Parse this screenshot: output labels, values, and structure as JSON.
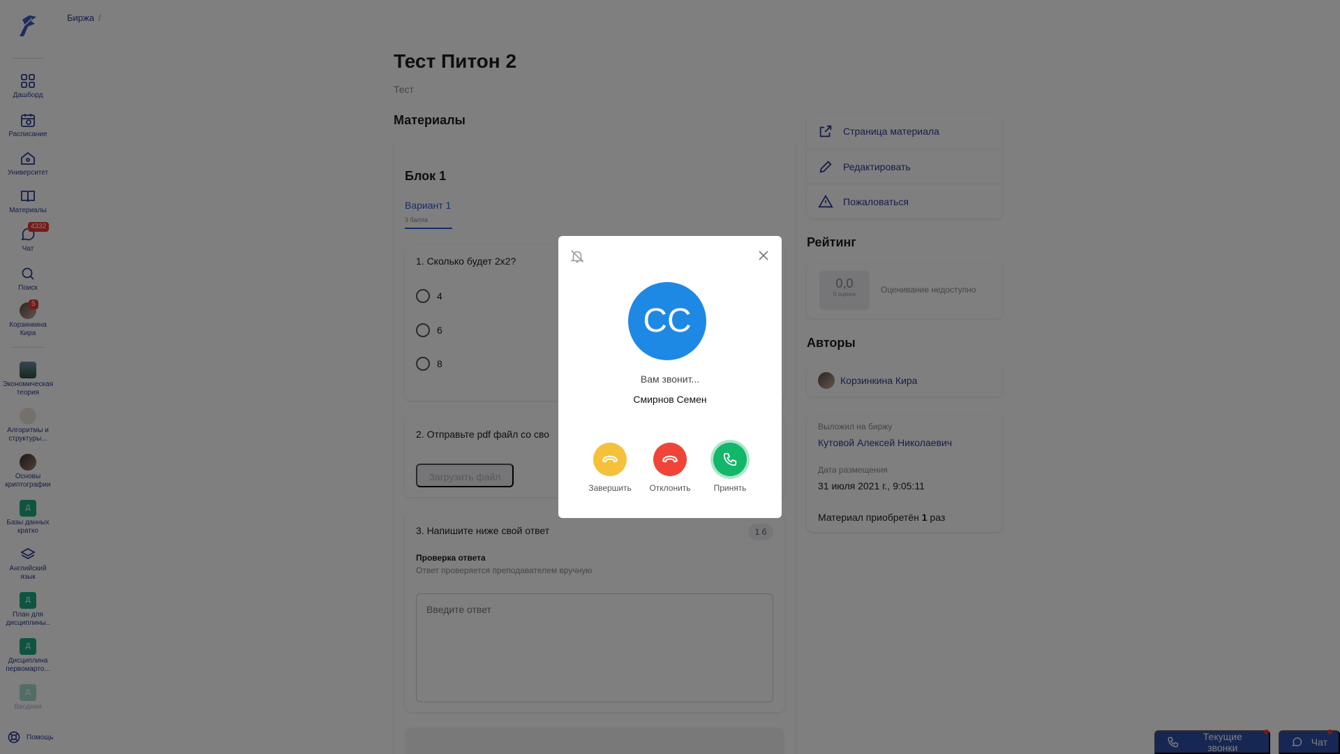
{
  "breadcrumb": {
    "item": "Биржа",
    "separator": "/"
  },
  "sidebar": {
    "items": [
      {
        "label": "Дашборд",
        "icon": "dashboard-icon"
      },
      {
        "label": "Расписание",
        "icon": "calendar-icon"
      },
      {
        "label": "Университет",
        "icon": "university-icon"
      },
      {
        "label": "Материалы",
        "icon": "book-icon"
      },
      {
        "label": "Чат",
        "icon": "chat-icon",
        "badge": "4332"
      },
      {
        "label": "Поиск",
        "icon": "search-icon"
      },
      {
        "label": "Корзинкина Кира",
        "icon": "avatar",
        "badge": "5"
      }
    ],
    "courses": [
      {
        "label": "Экономическая теория"
      },
      {
        "label": "Алгоритмы и структуры..."
      },
      {
        "label": "Основы криптографии"
      },
      {
        "label": "Базы данных кратко",
        "letter": "Д"
      },
      {
        "label": "Английский язык"
      },
      {
        "label": "План для дисциплины..",
        "letter": "Д"
      },
      {
        "label": "Дисциплина первомарто...",
        "letter": "Д"
      },
      {
        "label": "Вводная",
        "letter": "Д"
      }
    ],
    "help": "Помощь"
  },
  "page": {
    "title": "Тест Питон 2",
    "subtitle": "Тест",
    "materials_heading": "Материалы"
  },
  "block": {
    "title": "Блок 1",
    "variant_label": "Вариант 1",
    "variant_points": "3 балла",
    "q1": {
      "text": "1. Сколько будет 2х2?",
      "options": [
        "4",
        "6",
        "8"
      ]
    },
    "q2": {
      "text": "2. Отправьте pdf файл со сво",
      "upload_label": "Загрузить файл"
    },
    "q3": {
      "text": "3. Напишите ниже свой ответ",
      "badge": "1 б",
      "check_title": "Проверка ответа",
      "check_desc": "Ответ проверяется преподавателем вручную",
      "answer_placeholder": "Введите ответ"
    }
  },
  "actions": {
    "page_link": "Страница материала",
    "edit": "Редактировать",
    "report": "Пожаловаться"
  },
  "rating": {
    "heading": "Рейтинг",
    "value": "0,0",
    "count": "0 оценок",
    "unavailable": "Оценивание недоступно"
  },
  "authors": {
    "heading": "Авторы",
    "name": "Корзинкина Кира"
  },
  "meta": {
    "posted_label": "Выложил на биржу",
    "posted_by": "Кутовой Алексей Николаевич",
    "date_label": "Дата размещения",
    "date_value": "31 июля 2021 г., 9:05:11",
    "purchased_prefix": "Материал приобретён",
    "purchased_count": "1",
    "purchased_suffix": "раз"
  },
  "call_modal": {
    "avatar_initials": "СС",
    "calling_text": "Вам звонит...",
    "caller_name": "Смирнов Семен",
    "end_label": "Завершить",
    "decline_label": "Отклонить",
    "accept_label": "Принять"
  },
  "bottom": {
    "current_calls": "Текущие звонки",
    "chat": "Чат"
  },
  "colors": {
    "accent": "#2a3d8f",
    "link": "#2a5bd7",
    "end": "#f5c13a",
    "decline": "#f04438",
    "accept": "#12b76a",
    "avatar": "#1e88e5"
  }
}
